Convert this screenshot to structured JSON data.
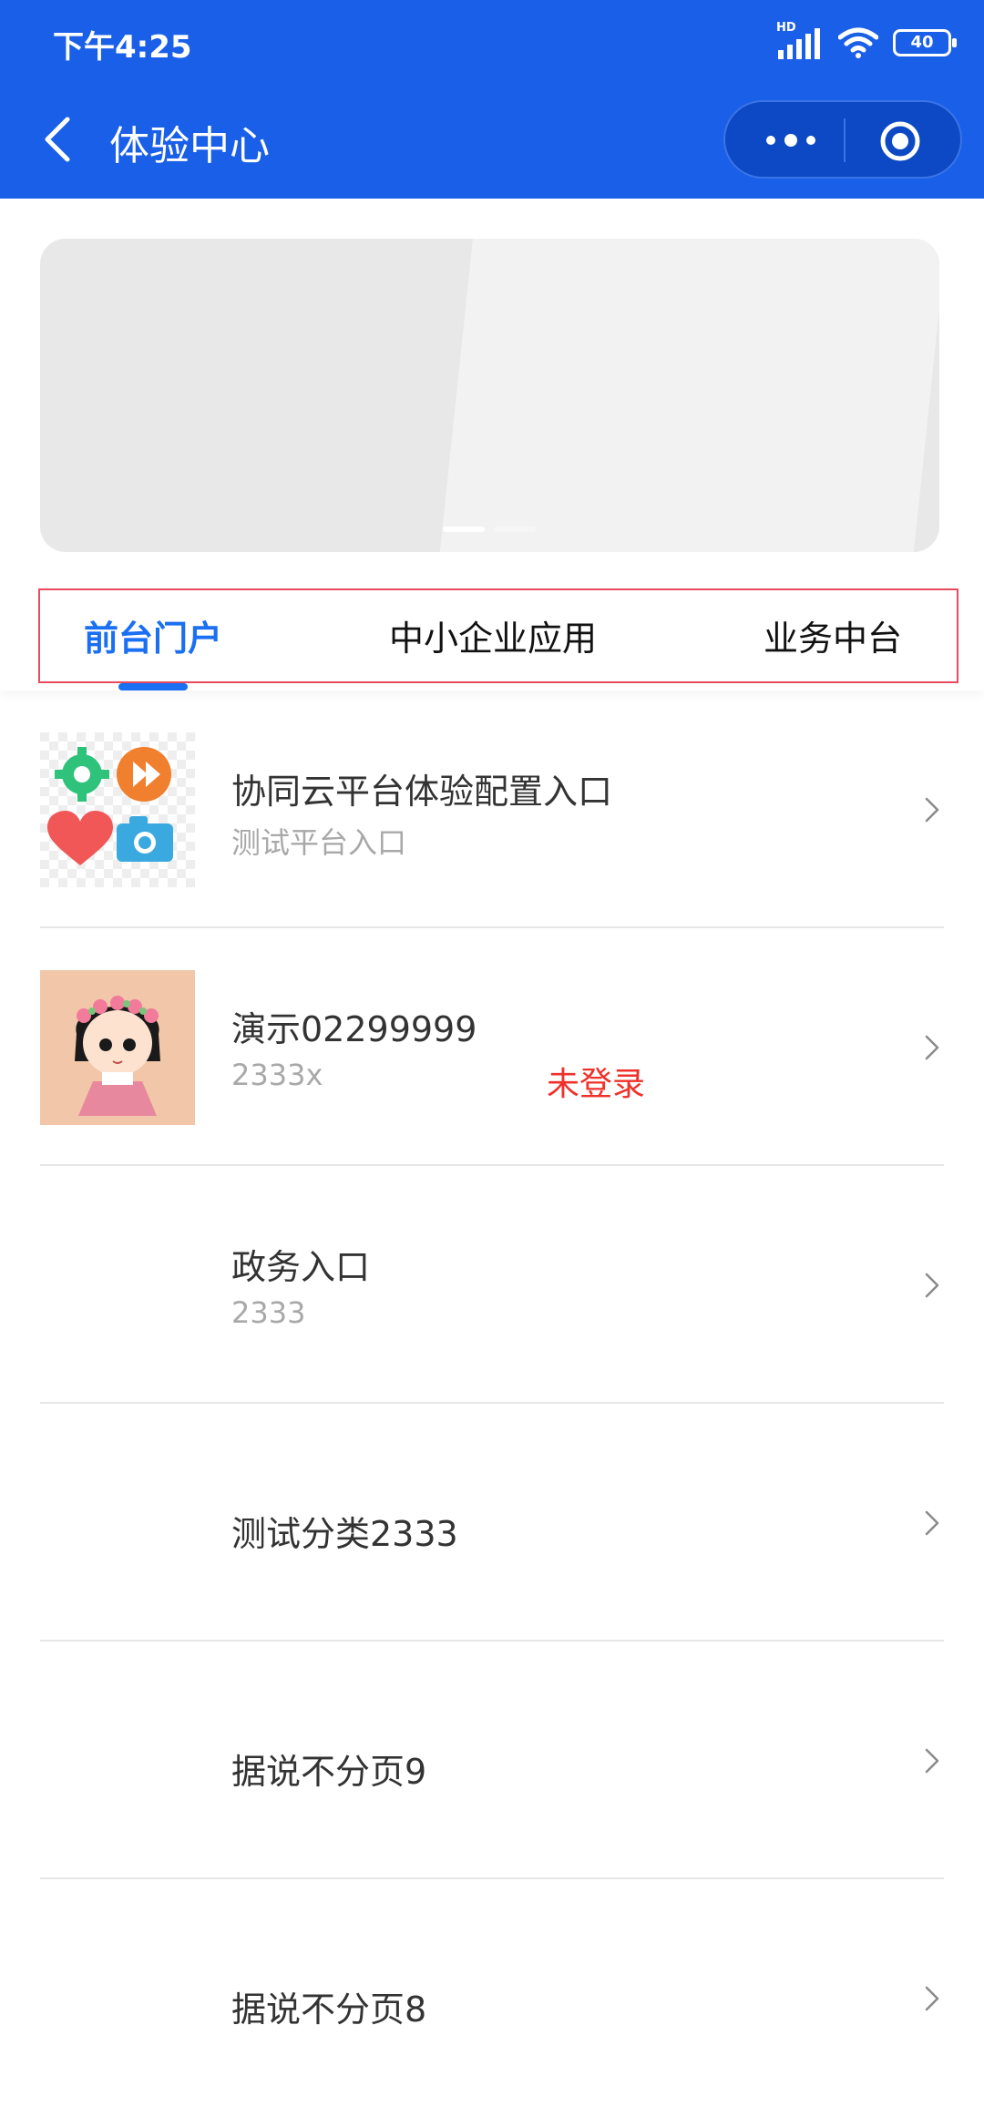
{
  "status_bar": {
    "time": "下午4:25",
    "network": "HD",
    "battery": "40"
  },
  "nav": {
    "title": "体验中心"
  },
  "tabs": [
    {
      "label": "前台门户",
      "active": true
    },
    {
      "label": "中小企业应用",
      "active": false
    },
    {
      "label": "业务中台",
      "active": false
    }
  ],
  "list": [
    {
      "title": "协同云平台体验配置入口",
      "subtitle": "测试平台入口",
      "status": ""
    },
    {
      "title": "演示02299999",
      "subtitle": "2333x",
      "status": "未登录"
    },
    {
      "title": "政务入口",
      "subtitle": "2333",
      "status": ""
    },
    {
      "title": "测试分类2333",
      "subtitle": "",
      "status": ""
    },
    {
      "title": "据说不分页9",
      "subtitle": "",
      "status": ""
    },
    {
      "title": "据说不分页8",
      "subtitle": "",
      "status": ""
    }
  ],
  "colors": {
    "header": "#1a5fe8",
    "active_tab": "#1a6ff2",
    "status_red": "#f0302a"
  }
}
